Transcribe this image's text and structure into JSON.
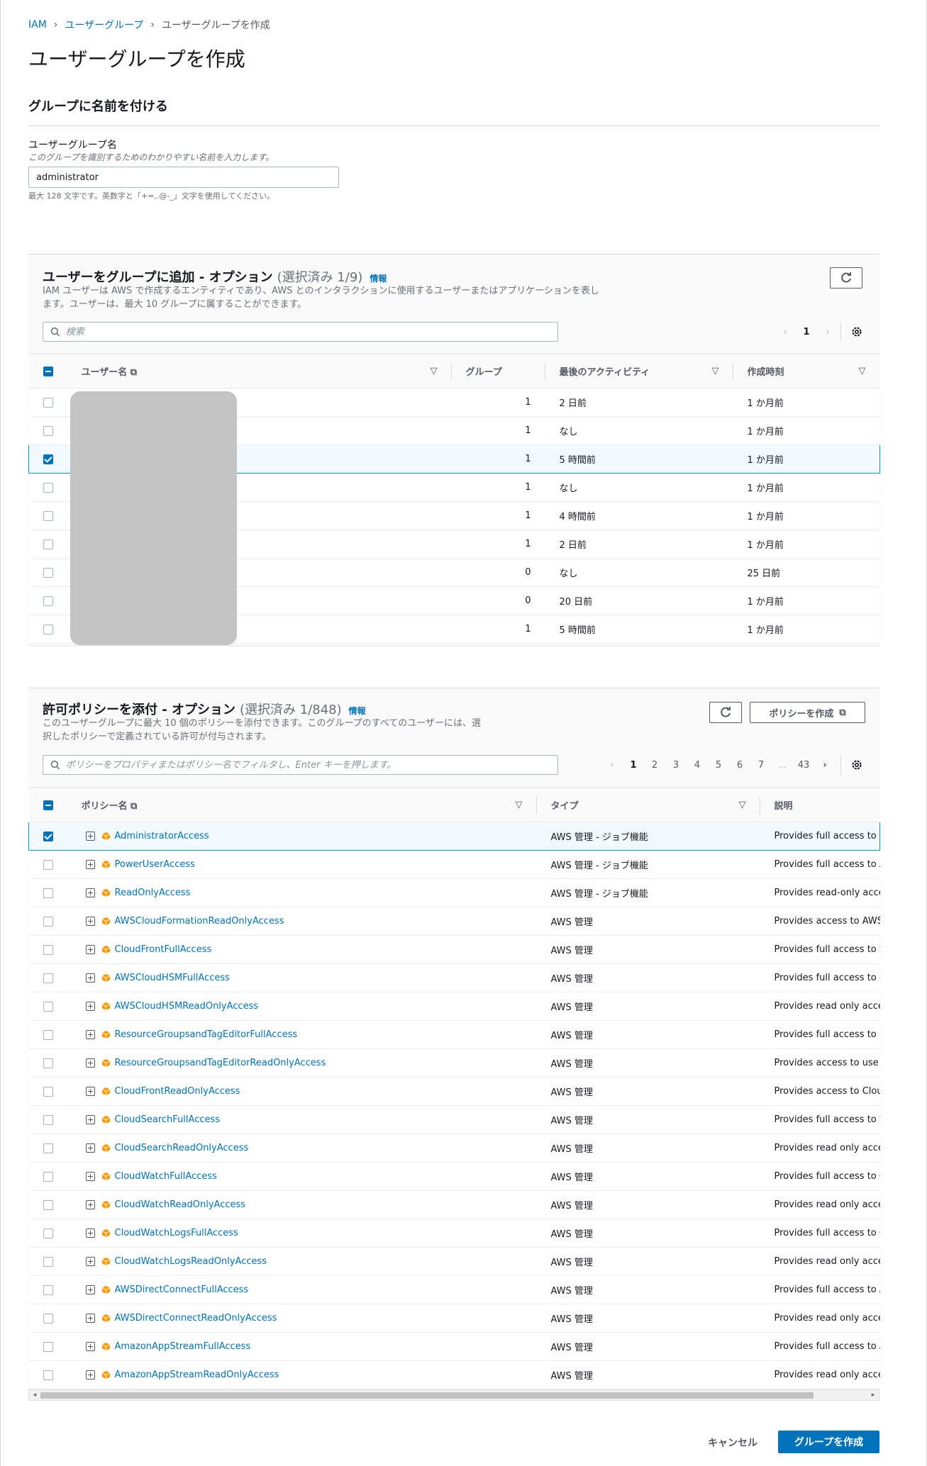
{
  "breadcrumb": {
    "root": "IAM",
    "parent": "ユーザーグループ",
    "current": "ユーザーグループを作成"
  },
  "page_title": "ユーザーグループを作成",
  "name_section": {
    "title": "グループに名前を付ける",
    "field_label": "ユーザーグループ名",
    "field_description": "このグループを識別するためのわかりやすい名前を入力します。",
    "field_value": "administrator",
    "constraint": "最大 128 文字です。英数字と「+=,.@-_」文字を使用してください。"
  },
  "users_panel": {
    "title": "ユーザーをグループに追加 - オプション",
    "count": "(選択済み 1/9)",
    "info": "情報",
    "description": "IAM ユーザーは AWS で作成するエンティティであり、AWS とのインタラクションに使用するユーザーまたはアプリケーションを表します。ユーザーは、最大 10 グループに属することができます。",
    "search_placeholder": "検索",
    "page": "1",
    "columns": [
      "ユーザー名",
      "グループ",
      "最後のアクティビティ",
      "作成時刻"
    ],
    "rows": [
      {
        "groups": "1",
        "last_activity": "2 日前",
        "created": "1 か月前",
        "checked": false
      },
      {
        "groups": "1",
        "last_activity": "なし",
        "created": "1 か月前",
        "checked": false
      },
      {
        "groups": "1",
        "last_activity": "5 時間前",
        "created": "1 か月前",
        "checked": true
      },
      {
        "groups": "1",
        "last_activity": "なし",
        "created": "1 か月前",
        "checked": false
      },
      {
        "groups": "1",
        "last_activity": "4 時間前",
        "created": "1 か月前",
        "checked": false
      },
      {
        "groups": "1",
        "last_activity": "2 日前",
        "created": "1 か月前",
        "checked": false
      },
      {
        "groups": "0",
        "last_activity": "なし",
        "created": "25 日前",
        "checked": false
      },
      {
        "groups": "0",
        "last_activity": "20 日前",
        "created": "1 か月前",
        "checked": false
      },
      {
        "groups": "1",
        "last_activity": "5 時間前",
        "created": "1 か月前",
        "checked": false
      }
    ]
  },
  "policy_panel": {
    "title": "許可ポリシーを添付 - オプション",
    "count": "(選択済み 1/848)",
    "info": "情報",
    "description": "このユーザーグループに最大 10 個のポリシーを添付できます。このグループのすべてのユーザーには、選択したポリシーで定義されている許可が付与されます。",
    "create_policy_label": "ポリシーを作成",
    "search_placeholder": "ポリシーをプロパティまたはポリシー名でフィルタし、Enter キーを押します。",
    "pages": [
      "1",
      "2",
      "3",
      "4",
      "5",
      "6",
      "7",
      "...",
      "43"
    ],
    "columns": [
      "ポリシー名",
      "タイプ",
      "説明"
    ],
    "rows": [
      {
        "name": "AdministratorAccess",
        "type": "AWS 管理 - ジョブ機能",
        "desc": "Provides full access to A",
        "checked": true
      },
      {
        "name": "PowerUserAccess",
        "type": "AWS 管理 - ジョブ機能",
        "desc": "Provides full access to A",
        "checked": false
      },
      {
        "name": "ReadOnlyAccess",
        "type": "AWS 管理 - ジョブ機能",
        "desc": "Provides read-only acce",
        "checked": false
      },
      {
        "name": "AWSCloudFormationReadOnlyAccess",
        "type": "AWS 管理",
        "desc": "Provides access to AWS",
        "checked": false
      },
      {
        "name": "CloudFrontFullAccess",
        "type": "AWS 管理",
        "desc": "Provides full access to th",
        "checked": false
      },
      {
        "name": "AWSCloudHSMFullAccess",
        "type": "AWS 管理",
        "desc": "Provides full access to a",
        "checked": false
      },
      {
        "name": "AWSCloudHSMReadOnlyAccess",
        "type": "AWS 管理",
        "desc": "Provides read only acce",
        "checked": false
      },
      {
        "name": "ResourceGroupsandTagEditorFullAccess",
        "type": "AWS 管理",
        "desc": "Provides full access to R",
        "checked": false
      },
      {
        "name": "ResourceGroupsandTagEditorReadOnlyAccess",
        "type": "AWS 管理",
        "desc": "Provides access to use",
        "checked": false
      },
      {
        "name": "CloudFrontReadOnlyAccess",
        "type": "AWS 管理",
        "desc": "Provides access to Clou",
        "checked": false
      },
      {
        "name": "CloudSearchFullAccess",
        "type": "AWS 管理",
        "desc": "Provides full access to th",
        "checked": false
      },
      {
        "name": "CloudSearchReadOnlyAccess",
        "type": "AWS 管理",
        "desc": "Provides read only acce",
        "checked": false
      },
      {
        "name": "CloudWatchFullAccess",
        "type": "AWS 管理",
        "desc": "Provides full access to C",
        "checked": false
      },
      {
        "name": "CloudWatchReadOnlyAccess",
        "type": "AWS 管理",
        "desc": "Provides read only acce",
        "checked": false
      },
      {
        "name": "CloudWatchLogsFullAccess",
        "type": "AWS 管理",
        "desc": "Provides full access to C",
        "checked": false
      },
      {
        "name": "CloudWatchLogsReadOnlyAccess",
        "type": "AWS 管理",
        "desc": "Provides read only acce",
        "checked": false
      },
      {
        "name": "AWSDirectConnectFullAccess",
        "type": "AWS 管理",
        "desc": "Provides full access to A",
        "checked": false
      },
      {
        "name": "AWSDirectConnectReadOnlyAccess",
        "type": "AWS 管理",
        "desc": "Provides read only acce",
        "checked": false
      },
      {
        "name": "AmazonAppStreamFullAccess",
        "type": "AWS 管理",
        "desc": "Provides full access to A",
        "checked": false
      },
      {
        "name": "AmazonAppStreamReadOnlyAccess",
        "type": "AWS 管理",
        "desc": "Provides read only acce",
        "checked": false
      }
    ]
  },
  "footer": {
    "cancel": "キャンセル",
    "create": "グループを作成"
  },
  "colors": {
    "link": "#0073bb",
    "primary": "#0073bb",
    "selected_row": "#f1faff",
    "policy_icon": "#ff9900"
  }
}
